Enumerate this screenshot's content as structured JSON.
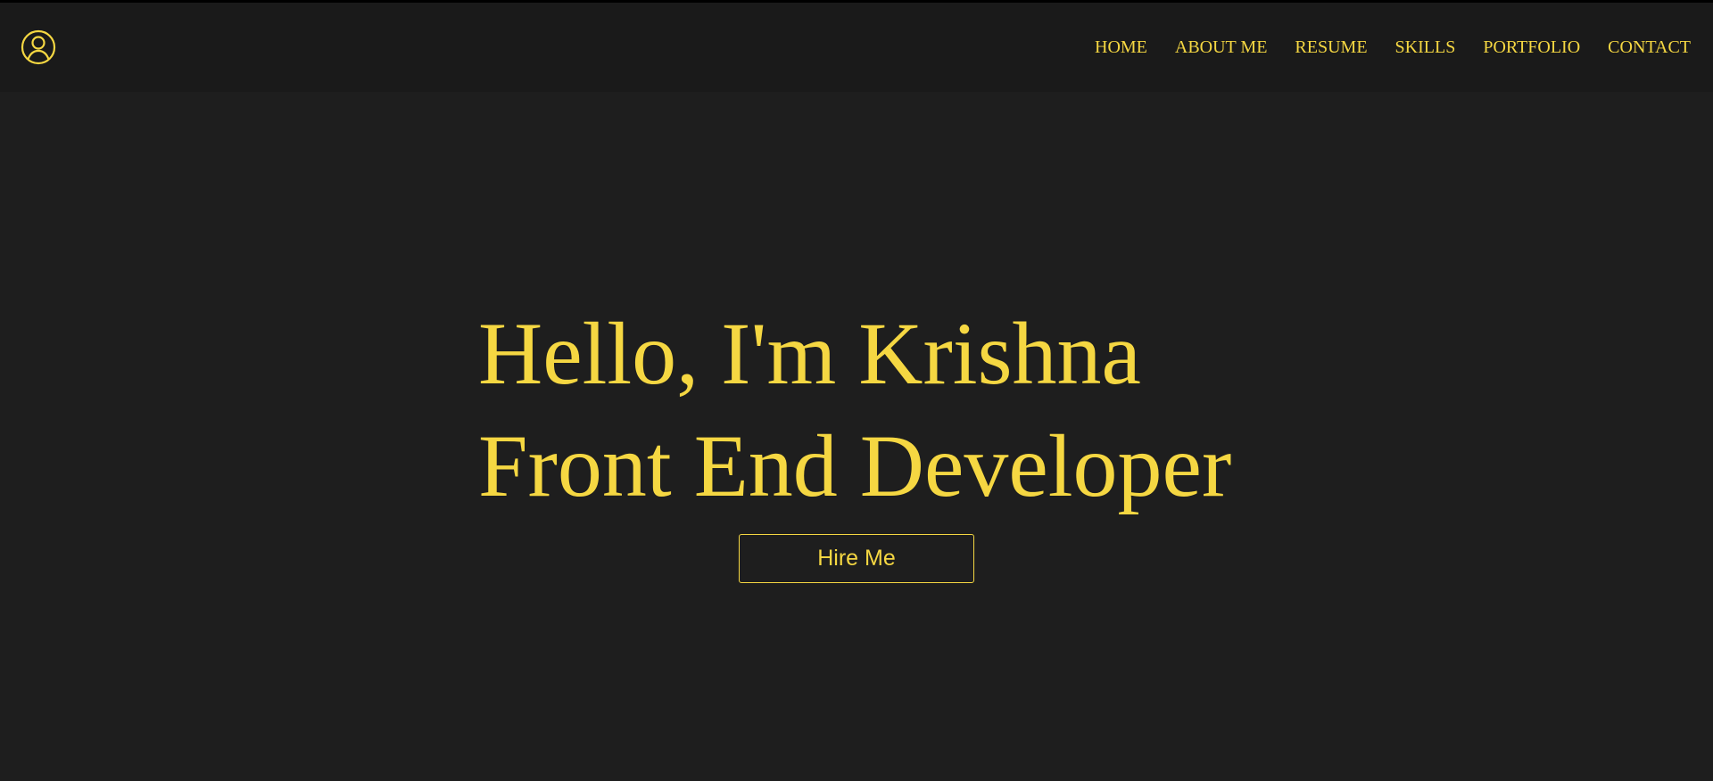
{
  "theme": {
    "accent": "#f5d742",
    "background": "#1e1e1e",
    "navbar_background": "#1a1a1a"
  },
  "navbar": {
    "logo_icon": "user-circle-icon",
    "links": [
      {
        "label": "HOME"
      },
      {
        "label": "ABOUT ME"
      },
      {
        "label": "RESUME"
      },
      {
        "label": "SKILLS"
      },
      {
        "label": "PORTFOLIO"
      },
      {
        "label": "CONTACT"
      }
    ]
  },
  "hero": {
    "line1": "Hello, I'm Krishna",
    "line2": "Front End Developer",
    "cta_label": "Hire Me"
  }
}
